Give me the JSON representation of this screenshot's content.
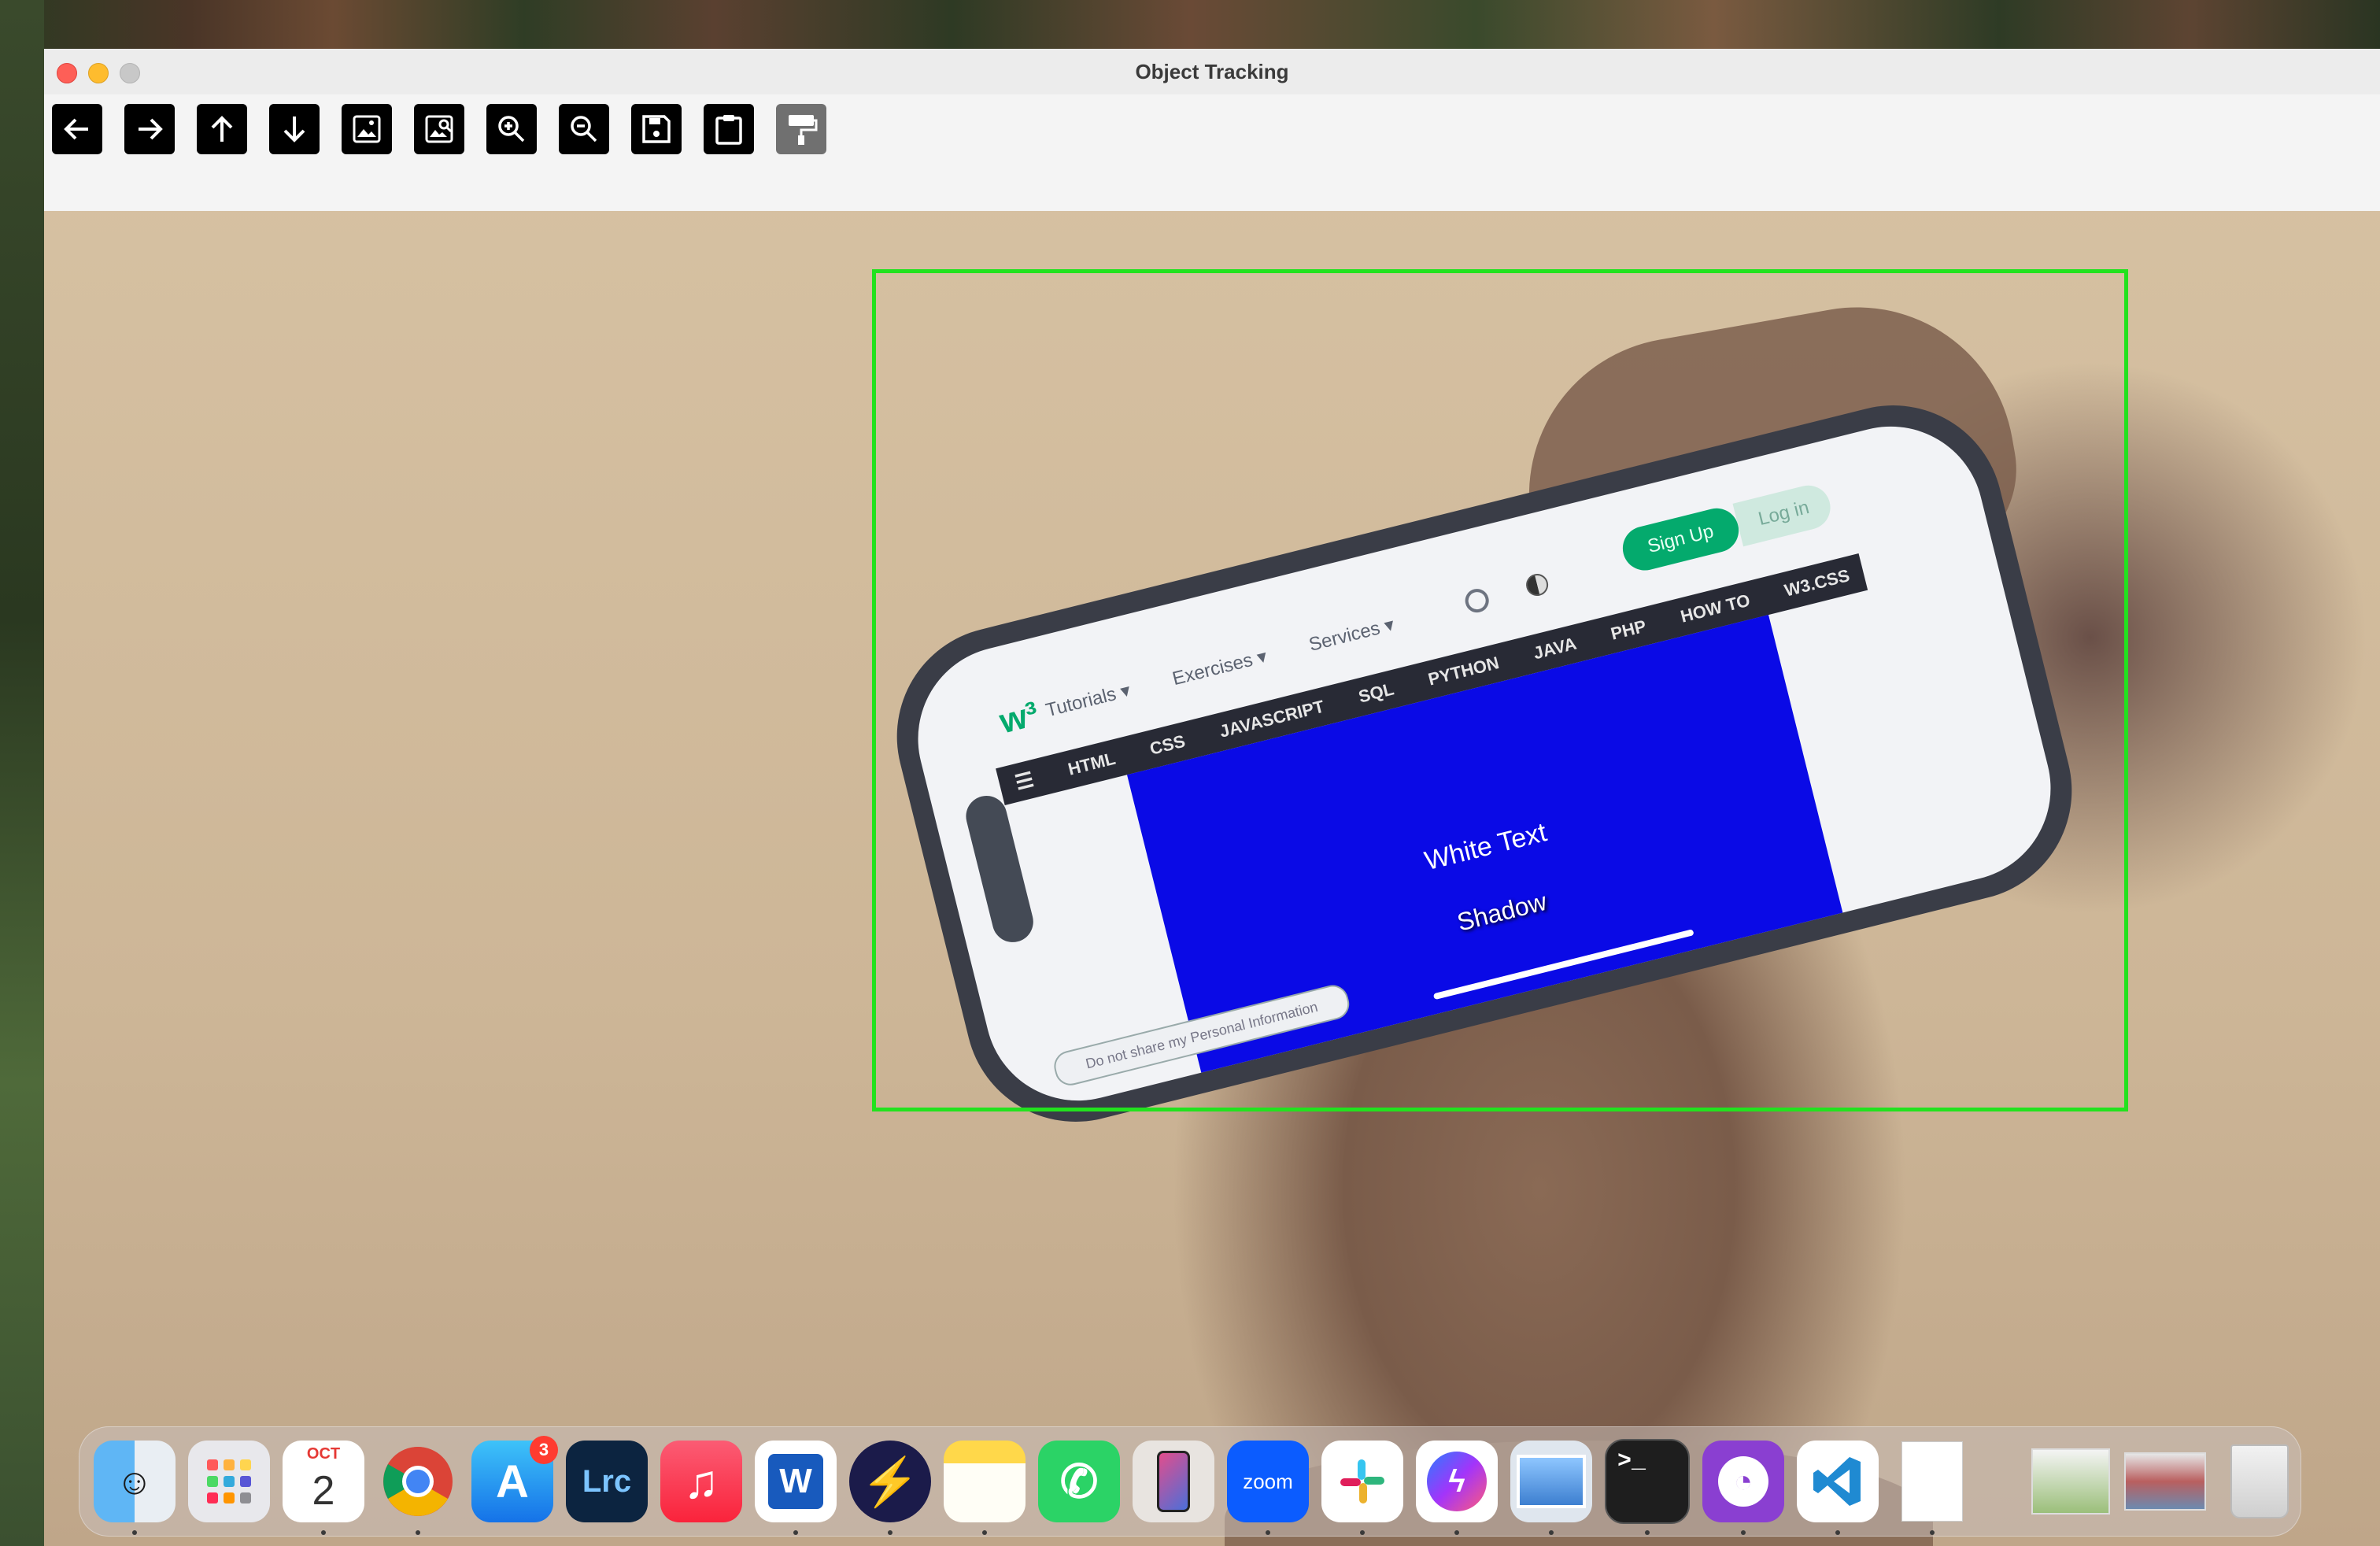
{
  "window": {
    "title": "Object Tracking"
  },
  "toolbar": {
    "buttons": [
      {
        "name": "back-button",
        "icon": "arrow-left-icon"
      },
      {
        "name": "forward-button",
        "icon": "arrow-right-icon"
      },
      {
        "name": "up-button",
        "icon": "arrow-up-icon"
      },
      {
        "name": "down-button",
        "icon": "arrow-down-icon"
      },
      {
        "name": "image-button",
        "icon": "image-icon"
      },
      {
        "name": "image-search-button",
        "icon": "image-search-icon"
      },
      {
        "name": "zoom-in-button",
        "icon": "zoom-in-icon"
      },
      {
        "name": "zoom-out-button",
        "icon": "zoom-out-icon"
      },
      {
        "name": "save-button",
        "icon": "save-icon"
      },
      {
        "name": "clipboard-button",
        "icon": "clipboard-icon"
      },
      {
        "name": "paint-button",
        "icon": "paint-roller-icon",
        "disabled": true
      }
    ]
  },
  "video": {
    "tracking_box_color": "#22e21e",
    "phone_screen": {
      "url": "w3schools.com",
      "nav": [
        "Tutorials ▾",
        "Exercises ▾",
        "Services ▾"
      ],
      "sign_up": "Sign Up",
      "log_in": "Log in",
      "topnav": [
        "HTML",
        "CSS",
        "JAVASCRIPT",
        "SQL",
        "PYTHON",
        "JAVA",
        "PHP",
        "HOW TO",
        "W3.CSS"
      ],
      "box_text_1": "White Text",
      "box_text_2": "Shadow",
      "cookie_text": "Do not share my Personal Information"
    }
  },
  "dock": {
    "calendar": {
      "month": "OCT",
      "day": "2"
    },
    "app_store_badge": "3",
    "lightroom_label": "Lrc",
    "zoom_label": "zoom",
    "word_label": "W",
    "apps": [
      "Finder",
      "Launchpad",
      "Calendar",
      "Chrome",
      "App Store",
      "Lightroom Classic",
      "Music",
      "Word",
      "Reeder",
      "Notes",
      "WhatsApp",
      "iPhone Mirroring",
      "Zoom",
      "Slack",
      "Messenger",
      "Preview",
      "Terminal",
      "GitHub Desktop",
      "Visual Studio Code",
      "Document"
    ]
  }
}
